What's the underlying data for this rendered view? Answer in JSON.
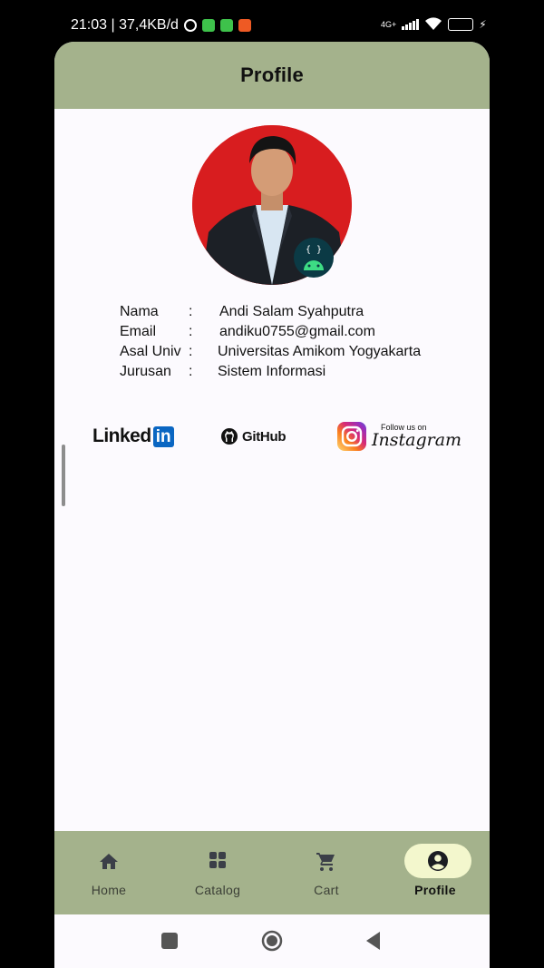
{
  "status_bar": {
    "left_text": "21:03 | 37,4KB/d",
    "network": "4G+",
    "battery": "64"
  },
  "header": {
    "title": "Profile"
  },
  "profile": {
    "fields": [
      {
        "label": "Nama",
        "separator": ":",
        "value": "Andi Salam Syahputra"
      },
      {
        "label": "Email",
        "separator": ":",
        "value": "andiku0755@gmail.com"
      },
      {
        "label": "Asal Univ",
        "separator": ":",
        "value": "Universitas Amikom Yogyakarta"
      },
      {
        "label": "Jurusan",
        "separator": ":",
        "value": "Sistem Informasi"
      }
    ],
    "avatar_color": "#d81d1f"
  },
  "social": {
    "linkedin_word": "Linked",
    "linkedin_box": "in",
    "github": "GitHub",
    "instagram_follow": "Follow us on",
    "instagram_name": "Instagram"
  },
  "bottom_nav": {
    "items": [
      {
        "label": "Home",
        "icon": "home-icon"
      },
      {
        "label": "Catalog",
        "icon": "grid-icon"
      },
      {
        "label": "Cart",
        "icon": "cart-icon"
      },
      {
        "label": "Profile",
        "icon": "account-circle-icon",
        "active": true
      }
    ]
  },
  "colors": {
    "bar": "#a4b28c",
    "active_pill": "#f3f7cd",
    "background": "#fcfafe"
  }
}
